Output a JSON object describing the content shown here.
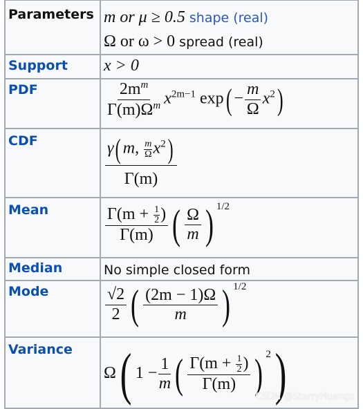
{
  "rows": {
    "parameters": {
      "label": "Parameters",
      "line1_math": "m or μ ≥ 0.5",
      "line1_shape": "shape",
      "line1_real": "(real)",
      "line2_math": "Ω or ω > 0",
      "line2_text": "spread (real)"
    },
    "support": {
      "label": "Support",
      "math": "x > 0"
    },
    "pdf": {
      "label": "PDF",
      "num": "2m",
      "num_sup": "m",
      "den": "Γ(m)Ω",
      "den_sup": "m",
      "x": "x",
      "x_sup": "2m−1",
      "exp": "exp",
      "minus": "−",
      "fnum": "m",
      "fden": "Ω",
      "x2": "x",
      "sq": "2"
    },
    "cdf": {
      "label": "CDF",
      "gamma": "γ",
      "m": "m,",
      "snum": "m",
      "sden": "Ω",
      "x": "x",
      "sq": "2",
      "den": "Γ(m)"
    },
    "mean": {
      "label": "Mean",
      "num_a": "Γ(m + ",
      "half_n": "1",
      "half_d": "2",
      "num_b": ")",
      "den": "Γ(m)",
      "pnum": "Ω",
      "pden": "m",
      "exp": "1/2"
    },
    "median": {
      "label": "Median",
      "text": "No simple closed form"
    },
    "mode": {
      "label": "Mode",
      "sqrt": "√2",
      "two": "2",
      "pnum": "(2m − 1)Ω",
      "pden": "m",
      "exp": "1/2"
    },
    "variance": {
      "label": "Variance",
      "omega": "Ω",
      "one_minus": "1 −",
      "fn": "1",
      "fd": "m",
      "num_a": "Γ(m + ",
      "half_n": "1",
      "half_d": "2",
      "num_b": ")",
      "den": "Γ(m)",
      "sq": "2"
    }
  },
  "watermark": "CSDN @StarryHuangx",
  "colors": {
    "link": "#0b4fb3",
    "border": "#a2a9b1",
    "background": "#f8f9fa"
  }
}
